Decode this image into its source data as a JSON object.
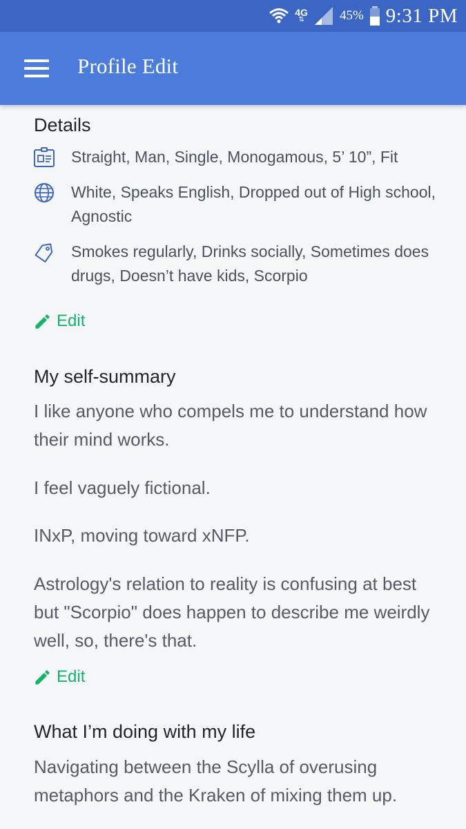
{
  "status_bar": {
    "network": "4G",
    "battery": "45%",
    "time": "9:31 PM",
    "icons": [
      "wifi-icon",
      "lte-icon",
      "signal-icon",
      "battery-icon"
    ]
  },
  "app_bar": {
    "title": "Profile Edit",
    "menu_icon": "hamburger-menu-icon"
  },
  "details": {
    "title": "Details",
    "rows": [
      {
        "icon": "id-card-icon",
        "text": "Straight, Man, Single, Monogamous, 5’ 10”, Fit"
      },
      {
        "icon": "globe-icon",
        "text": "White, Speaks English, Dropped out of High school, Agnostic"
      },
      {
        "icon": "tag-icon",
        "text": "Smokes regularly, Drinks socially, Sometimes does drugs, Doesn’t have kids, Scorpio"
      }
    ],
    "edit_label": "Edit"
  },
  "self_summary": {
    "title": "My self-summary",
    "paragraphs": [
      "I like anyone who compels me to understand how their mind works.",
      "I feel vaguely fictional.",
      "INxP, moving toward xNFP.",
      "Astrology's relation to reality is confusing at best but \"Scorpio\" does happen to describe me weirdly well, so, there's that."
    ],
    "edit_label": "Edit"
  },
  "life": {
    "title": "What I’m doing with my life",
    "text": "Navigating between the Scylla of overusing metaphors and the Kraken of mixing them up."
  },
  "colors": {
    "status_bar": "#3b66c3",
    "app_bar": "#4b7bdb",
    "background": "#f5f6f8",
    "accent_green": "#14b26a",
    "icon_blue": "#3b66c3"
  }
}
